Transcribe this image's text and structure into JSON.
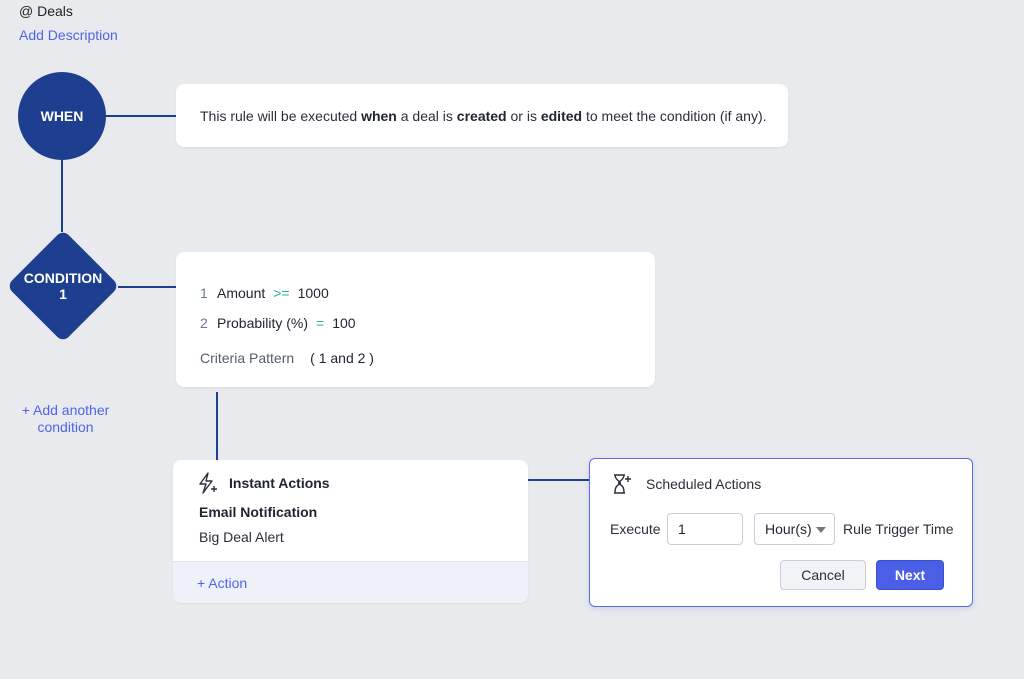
{
  "header": {
    "module": "@ Deals",
    "add_description": "Add Description"
  },
  "when": {
    "label": "WHEN",
    "text_pre": "This rule will be executed ",
    "text_when": "when",
    "text_mid1": " a deal is ",
    "text_created": "created",
    "text_mid2": " or is ",
    "text_edited": "edited",
    "text_post": " to meet the condition (if any)."
  },
  "condition": {
    "label": "CONDITION",
    "number": "1",
    "criteria": [
      {
        "num": "1",
        "field": "Amount",
        "op": ">=",
        "value": "1000"
      },
      {
        "num": "2",
        "field": "Probability (%)",
        "op": "=",
        "value": "100"
      }
    ],
    "pattern_label": "Criteria Pattern",
    "pattern_value": "( 1 and 2 )",
    "add_another": "+ Add another condition"
  },
  "instant_actions": {
    "title": "Instant Actions",
    "action_type": "Email Notification",
    "action_name": "Big Deal Alert",
    "add_action": "+ Action"
  },
  "scheduled_actions": {
    "title": "Scheduled Actions",
    "execute_label": "Execute",
    "execute_value": "1",
    "unit": "Hour(s)",
    "trigger_label": "Rule Trigger Time",
    "cancel": "Cancel",
    "next": "Next"
  },
  "colors": {
    "node": "#1e3f8f",
    "link": "#4f64e8",
    "operator": "#27b0a0",
    "primary_button": "#4a5fe6"
  }
}
